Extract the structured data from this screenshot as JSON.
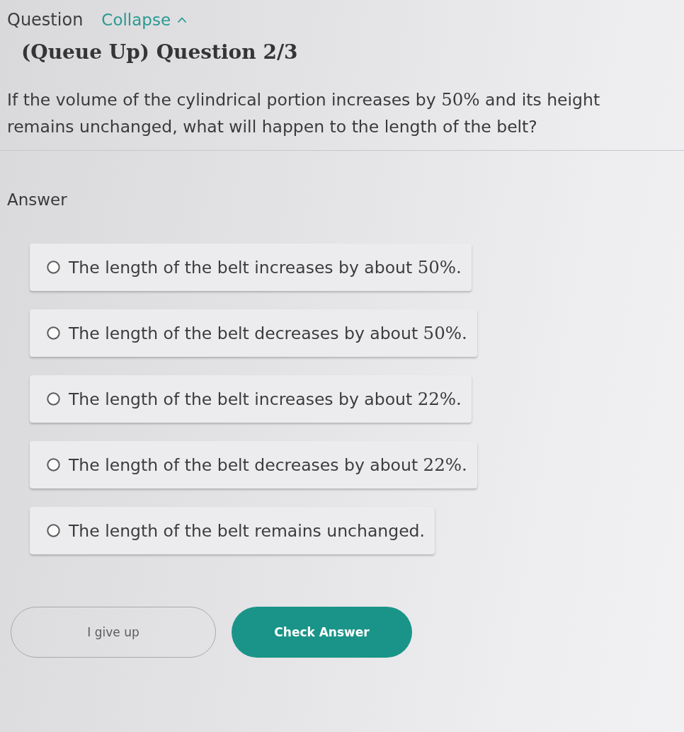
{
  "header": {
    "title": "Question",
    "collapse_link": "Collapse"
  },
  "question": {
    "heading": "(Queue Up) Question 2/3",
    "segments": [
      {
        "kind": "text",
        "text": "If the volume of the cylindrical portion increases by"
      },
      {
        "kind": "math",
        "text": "50%"
      },
      {
        "kind": "text",
        "text": "and its height remains unchanged, what will happen to the length of the belt?"
      }
    ]
  },
  "answer": {
    "label": "Answer",
    "options": [
      {
        "selected": false,
        "segments": [
          {
            "kind": "text",
            "text": "The length of the belt increases by about"
          },
          {
            "kind": "math",
            "text": "50%."
          }
        ]
      },
      {
        "selected": false,
        "segments": [
          {
            "kind": "text",
            "text": "The length of the belt decreases by about"
          },
          {
            "kind": "math",
            "text": "50%."
          }
        ]
      },
      {
        "selected": false,
        "segments": [
          {
            "kind": "text",
            "text": "The length of the belt increases by about"
          },
          {
            "kind": "math",
            "text": "22%."
          }
        ]
      },
      {
        "selected": false,
        "segments": [
          {
            "kind": "text",
            "text": "The length of the belt decreases by about"
          },
          {
            "kind": "math",
            "text": "22%."
          }
        ]
      },
      {
        "selected": false,
        "segments": [
          {
            "kind": "text",
            "text": "The length of the belt remains unchanged."
          }
        ]
      }
    ]
  },
  "buttons": [
    {
      "kind": "outline",
      "label": "I give up"
    },
    {
      "kind": "primary",
      "label": "Check Answer"
    }
  ]
}
